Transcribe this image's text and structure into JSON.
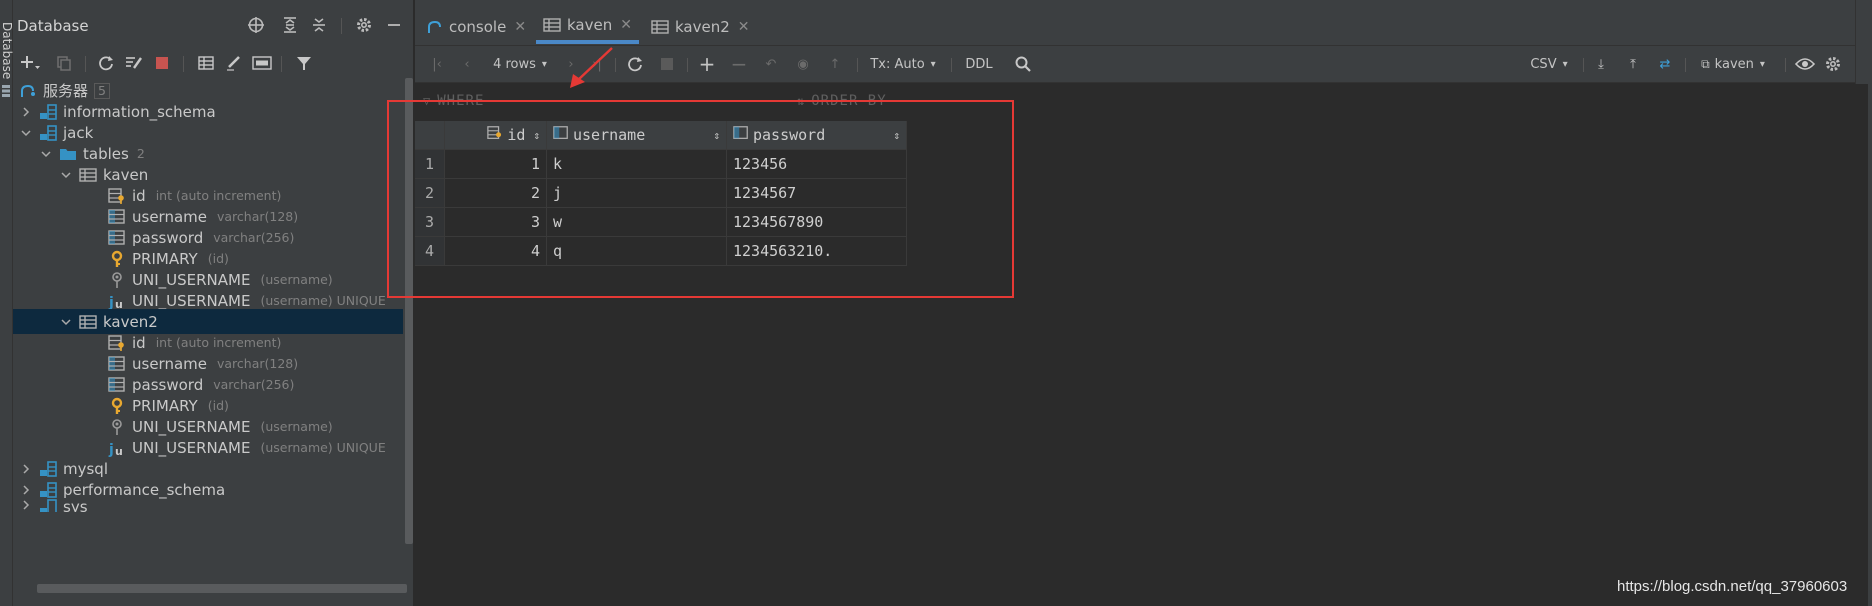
{
  "side_strip": {
    "label": "Database"
  },
  "db_panel": {
    "title": "Database",
    "tree": [
      {
        "label": "服务器",
        "badge": "5",
        "icon": "server-icon"
      },
      {
        "label": "information_schema",
        "icon": "schema-icon"
      },
      {
        "label": "jack",
        "icon": "schema-icon"
      },
      {
        "label": "tables",
        "sub": "2",
        "icon": "folder-icon"
      },
      {
        "label": "kaven",
        "icon": "table-icon"
      },
      {
        "label": "id",
        "sub": "int (auto increment)",
        "icon": "key-column-icon"
      },
      {
        "label": "username",
        "sub": "varchar(128)",
        "icon": "column-icon"
      },
      {
        "label": "password",
        "sub": "varchar(256)",
        "icon": "column-icon"
      },
      {
        "label": "PRIMARY",
        "sub": "(id)",
        "icon": "primary-key-icon"
      },
      {
        "label": "UNI_USERNAME",
        "sub": "(username)",
        "icon": "index-icon"
      },
      {
        "label": "UNI_USERNAME",
        "sub": "(username) UNIQUE",
        "icon": "unique-icon"
      },
      {
        "label": "kaven2",
        "icon": "table-icon"
      },
      {
        "label": "id",
        "sub": "int (auto increment)",
        "icon": "key-column-icon"
      },
      {
        "label": "username",
        "sub": "varchar(128)",
        "icon": "column-icon"
      },
      {
        "label": "password",
        "sub": "varchar(256)",
        "icon": "column-icon"
      },
      {
        "label": "PRIMARY",
        "sub": "(id)",
        "icon": "primary-key-icon"
      },
      {
        "label": "UNI_USERNAME",
        "sub": "(username)",
        "icon": "index-icon"
      },
      {
        "label": "UNI_USERNAME",
        "sub": "(username) UNIQUE",
        "icon": "unique-icon"
      },
      {
        "label": "mysql",
        "icon": "schema-icon"
      },
      {
        "label": "performance_schema",
        "icon": "schema-icon"
      },
      {
        "label": "sys",
        "icon": "schema-icon"
      }
    ]
  },
  "tabs": [
    {
      "label": "console",
      "icon": "console-icon",
      "active": false
    },
    {
      "label": "kaven",
      "icon": "table-icon",
      "active": true
    },
    {
      "label": "kaven2",
      "icon": "table-icon",
      "active": false
    }
  ],
  "toolbar": {
    "rows_label": "4 rows",
    "tx_label": "Tx: Auto",
    "ddl_label": "DDL",
    "export_format": "CSV",
    "datasource_label": "kaven"
  },
  "filters": {
    "where": "WHERE",
    "order_by": "ORDER BY"
  },
  "grid": {
    "columns": [
      "id",
      "username",
      "password"
    ],
    "rows": [
      {
        "num": "1",
        "id": "1",
        "username": "k",
        "password": "123456"
      },
      {
        "num": "2",
        "id": "2",
        "username": "j",
        "password": "1234567"
      },
      {
        "num": "3",
        "id": "3",
        "username": "w",
        "password": "1234567890"
      },
      {
        "num": "4",
        "id": "4",
        "username": "q",
        "password": "1234563210."
      }
    ]
  },
  "watermark": "https://blog.csdn.net/qq_37960603",
  "colors": {
    "accent": "#4a88c7",
    "highlight_box": "#e53935",
    "selection": "#0d293e"
  }
}
